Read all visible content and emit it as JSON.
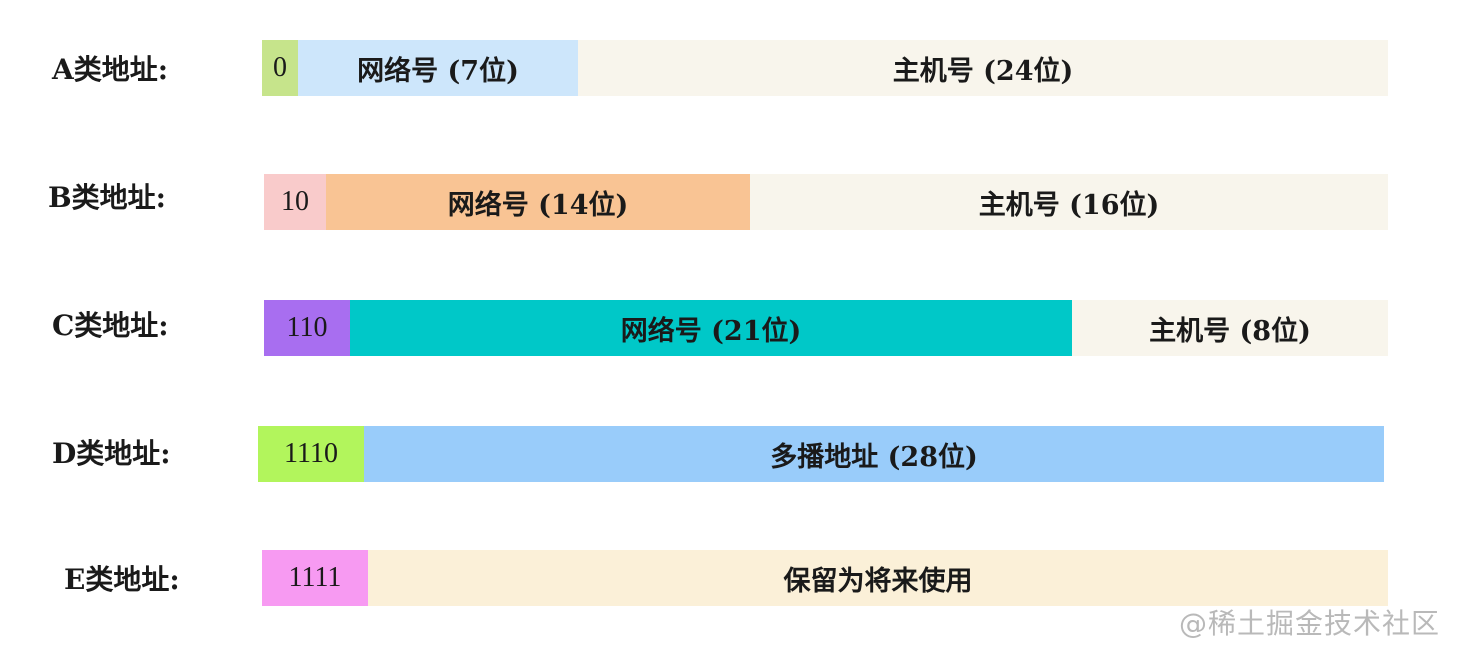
{
  "rows": [
    {
      "label": "A类地址:",
      "segments": [
        {
          "text": "0",
          "color": "#c6e48b"
        },
        {
          "text": "网络号 (7位)",
          "color": "#cde6fb"
        },
        {
          "text": "主机号 (24位)",
          "color": "#f8f5ec"
        }
      ]
    },
    {
      "label": "B类地址:",
      "segments": [
        {
          "text": "10",
          "color": "#f9cbcb"
        },
        {
          "text": "网络号 (14位)",
          "color": "#f9c494"
        },
        {
          "text": "主机号 (16位)",
          "color": "#f8f5ec"
        }
      ]
    },
    {
      "label": "C类地址:",
      "segments": [
        {
          "text": "110",
          "color": "#a86ef0"
        },
        {
          "text": "网络号 (21位)",
          "color": "#00c8c8"
        },
        {
          "text": "主机号 (8位)",
          "color": "#f8f5ec"
        }
      ]
    },
    {
      "label": "D类地址:",
      "segments": [
        {
          "text": "1110",
          "color": "#b2f55c"
        },
        {
          "text": "多播地址 (28位)",
          "color": "#99ccfa"
        }
      ]
    },
    {
      "label": "E类地址:",
      "segments": [
        {
          "text": "1111",
          "color": "#f79af2"
        },
        {
          "text": "保留为将来使用",
          "color": "#fbf0d8"
        }
      ]
    }
  ],
  "watermark": "@稀土掘金技术社区"
}
